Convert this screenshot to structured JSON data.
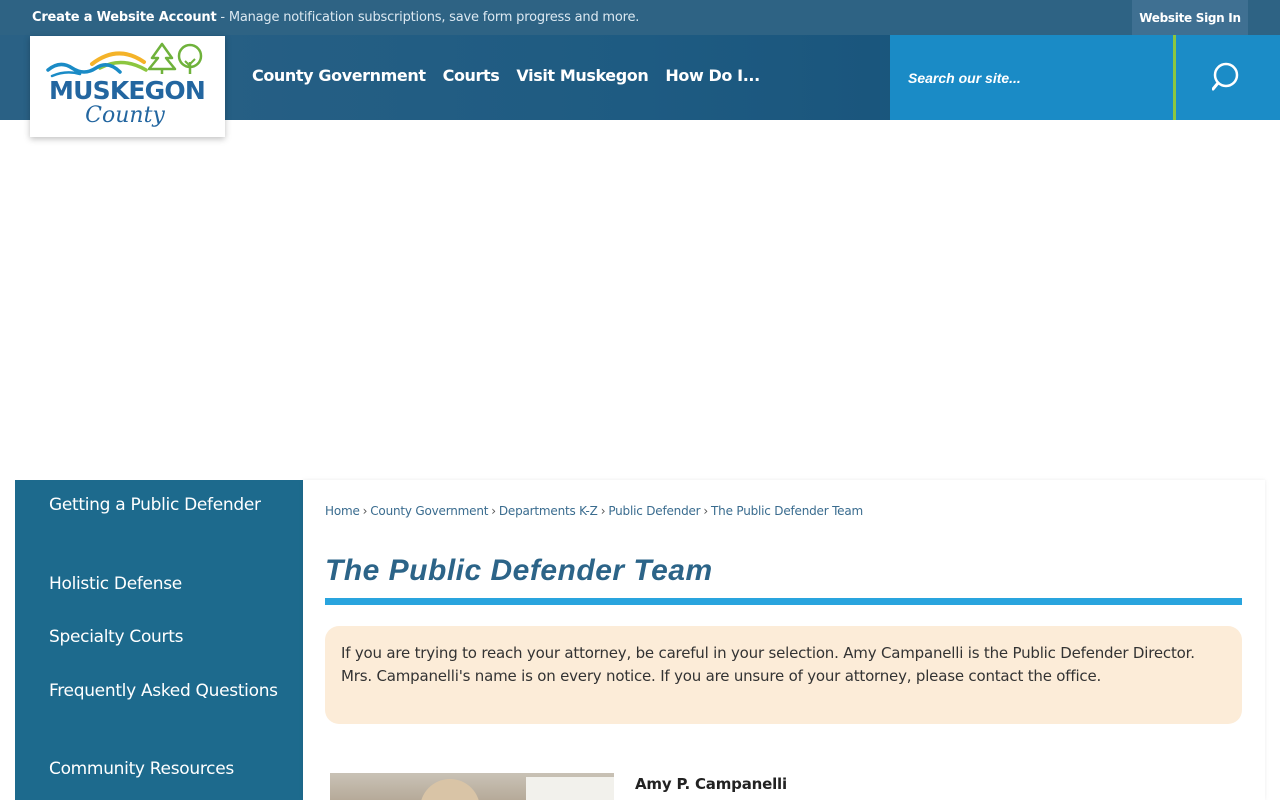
{
  "topbar": {
    "create_account_label": "Create a Website Account",
    "create_account_desc": " - Manage notification subscriptions, save form progress and more.",
    "sign_in_label": "Website Sign In"
  },
  "header": {
    "logo": {
      "line1": "MUSKEGON",
      "line2": "County"
    },
    "nav": [
      "County Government",
      "Courts",
      "Visit Muskegon",
      "How Do I..."
    ],
    "search": {
      "placeholder": "Search our site..."
    }
  },
  "sidebar": {
    "items": [
      "Getting a Public Defender",
      "Holistic Defense",
      "Specialty Courts",
      "Frequently Asked Questions",
      "Community Resources"
    ]
  },
  "main": {
    "breadcrumb": [
      "Home",
      "County Government",
      "Departments K-Z",
      "Public Defender",
      "The Public Defender Team"
    ],
    "breadcrumb_sep": "›",
    "title": "The Public Defender Team",
    "notice": "If you are trying to reach your attorney, be careful in your selection. Amy Campanelli is the Public Defender Director. Mrs. Campanelli's name is on every notice. If you are unsure of your attorney, please contact the office.",
    "staff": [
      {
        "name": "Amy P. Campanelli"
      }
    ]
  },
  "colors": {
    "topbar": "#2e6384",
    "header": "#1e5b82",
    "search": "#1a8bc6",
    "accent_green": "#8cc63f",
    "sidebar": "#1d6a8d",
    "title": "#2c6488",
    "title_rule": "#29a4de",
    "notice_bg": "#fcecd8"
  }
}
